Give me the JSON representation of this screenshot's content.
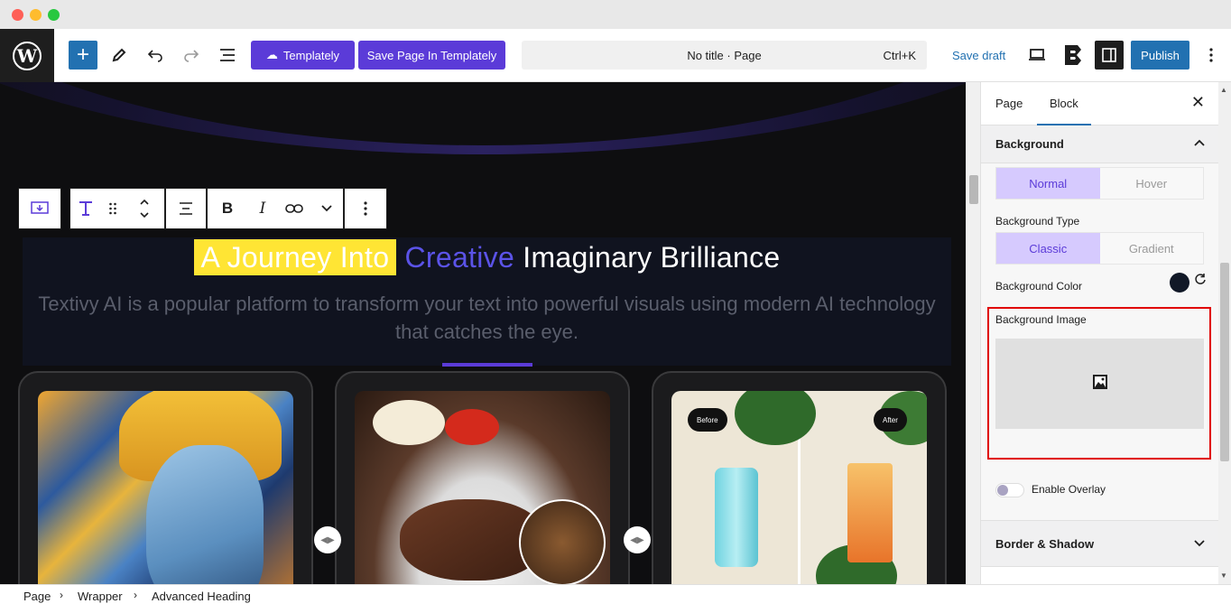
{
  "toolbar": {
    "templately_label": "Templately",
    "save_templately_label": "Save Page In Templately",
    "document_title": "No title · Page",
    "shortcut": "Ctrl+K",
    "save_draft_label": "Save draft",
    "publish_label": "Publish"
  },
  "canvas": {
    "heading_highlight": "A Journey Into",
    "heading_creative": "Creative",
    "heading_rest": "Imaginary Brilliance",
    "subtext": "Textivy AI is a popular platform to transform your text into powerful visuals using modern AI technology that catches the eye.",
    "before_label": "Before",
    "after_label": "After"
  },
  "sidebar": {
    "tab_page": "Page",
    "tab_block": "Block",
    "background_title": "Background",
    "state_normal": "Normal",
    "state_hover": "Hover",
    "bg_type_label": "Background Type",
    "type_classic": "Classic",
    "type_gradient": "Gradient",
    "bg_color_label": "Background Color",
    "bg_image_label": "Background Image",
    "overlay_label": "Enable Overlay",
    "border_shadow_title": "Border & Shadow"
  },
  "breadcrumb": [
    "Page",
    "Wrapper",
    "Advanced Heading"
  ],
  "colors": {
    "accent": "#5b3bd8",
    "wp_blue": "#2271b1",
    "highlight_yellow": "#ffe534",
    "creative_blue": "#5b53e8",
    "bg_color_swatch": "#111827",
    "selection_red": "#e00000"
  },
  "icons": {
    "wp_logo": "wordpress-logo-icon",
    "add": "plus-icon",
    "edit": "pencil-icon",
    "undo": "undo-icon",
    "redo": "redo-icon",
    "list_view": "list-view-icon",
    "view": "laptop-icon",
    "essential_blocks": "eb-logo-icon",
    "sidebar": "sidebar-toggle-icon",
    "more": "more-vertical-icon"
  }
}
